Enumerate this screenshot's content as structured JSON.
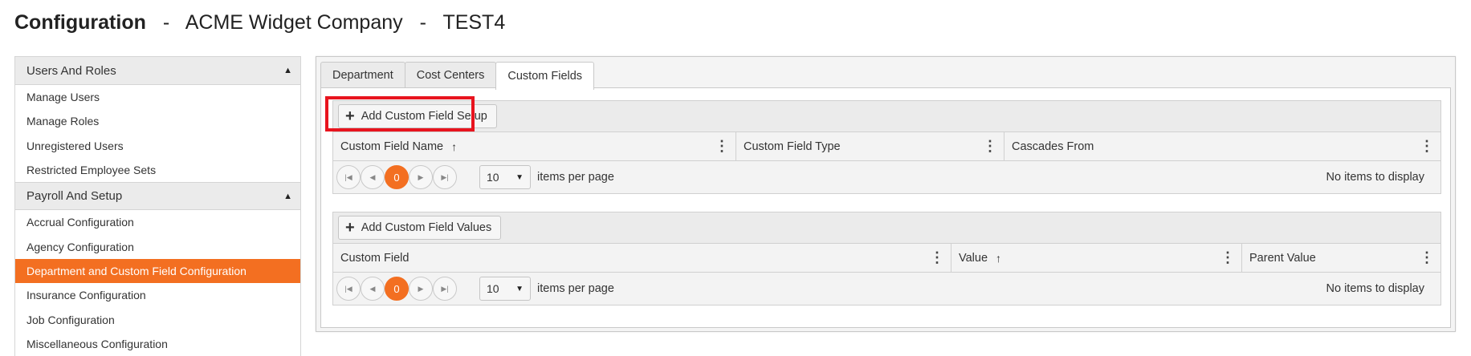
{
  "header": {
    "title": "Configuration",
    "separator": "-",
    "company": "ACME Widget Company",
    "environment": "TEST4"
  },
  "sidebar": {
    "groups": [
      {
        "label": "Users And Roles",
        "items": [
          "Manage Users",
          "Manage Roles",
          "Unregistered Users",
          "Restricted Employee Sets"
        ]
      },
      {
        "label": "Payroll And Setup",
        "items": [
          "Accrual Configuration",
          "Agency Configuration",
          "Department and Custom Field Configuration",
          "Insurance Configuration",
          "Job Configuration",
          "Miscellaneous Configuration"
        ]
      }
    ],
    "active_item": "Department and Custom Field Configuration",
    "collapse_glyph": "▲"
  },
  "tabs": [
    "Department",
    "Cost Centers",
    "Custom Fields"
  ],
  "active_tab": "Custom Fields",
  "grid1": {
    "add_button": "Add Custom Field Setup",
    "columns": [
      {
        "label": "Custom Field Name",
        "sorted": "asc"
      },
      {
        "label": "Custom Field Type"
      },
      {
        "label": "Cascades From"
      }
    ],
    "pager": {
      "current_page": "0",
      "page_size": "10",
      "items_per_page_label": "items per page",
      "empty_text": "No items to display"
    }
  },
  "grid2": {
    "add_button": "Add Custom Field Values",
    "columns": [
      {
        "label": "Custom Field"
      },
      {
        "label": "Value",
        "sorted": "asc"
      },
      {
        "label": "Parent Value"
      }
    ],
    "pager": {
      "current_page": "0",
      "page_size": "10",
      "items_per_page_label": "items per page",
      "empty_text": "No items to display"
    }
  },
  "icons": {
    "plus": "+",
    "sort_up": "↑",
    "kebab": "⋮",
    "first": "|◀",
    "prev": "◀",
    "next": "▶",
    "last": "▶|",
    "dropdown": "▼"
  },
  "colors": {
    "accent": "#f36f21",
    "highlight_border": "#e8141e"
  }
}
